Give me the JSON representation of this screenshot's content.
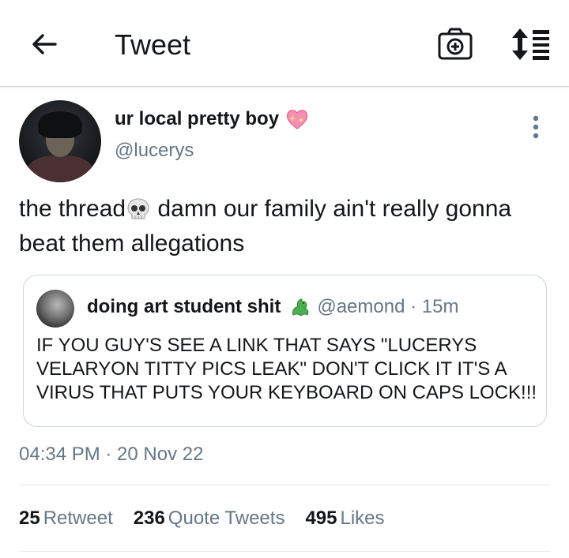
{
  "header": {
    "title": "Tweet",
    "back_icon": "arrow-left-icon",
    "camera_icon": "camera-plus-icon",
    "sort_icon": "sort-list-icon"
  },
  "tweet": {
    "author": {
      "display_name": "ur local pretty boy",
      "name_emoji": "sparkling-heart-icon",
      "handle": "@lucerys"
    },
    "text_part1": "the thread",
    "text_emoji": "skull-icon",
    "text_part2": " damn our family ain't really gonna beat them allegations",
    "timestamp": "04:34 PM · 20 Nov 22"
  },
  "quote": {
    "display_name": "doing art student shit",
    "name_emoji": "dragon-icon",
    "meta": "@aemond · 15m",
    "text": "IF YOU GUY'S SEE A LINK THAT SAYS \"LUCERYS VELARYON TITTY PICS LEAK\" DON'T CLICK IT IT'S A VIRUS THAT PUTS YOUR KEYBOARD ON CAPS LOCK!!!"
  },
  "stats": [
    {
      "count": "25",
      "label": "Retweet"
    },
    {
      "count": "236",
      "label": "Quote Tweets"
    },
    {
      "count": "495",
      "label": "Likes"
    }
  ],
  "colors": {
    "text": "#14171a",
    "secondary": "#657786",
    "border": "#ccd6dd"
  }
}
